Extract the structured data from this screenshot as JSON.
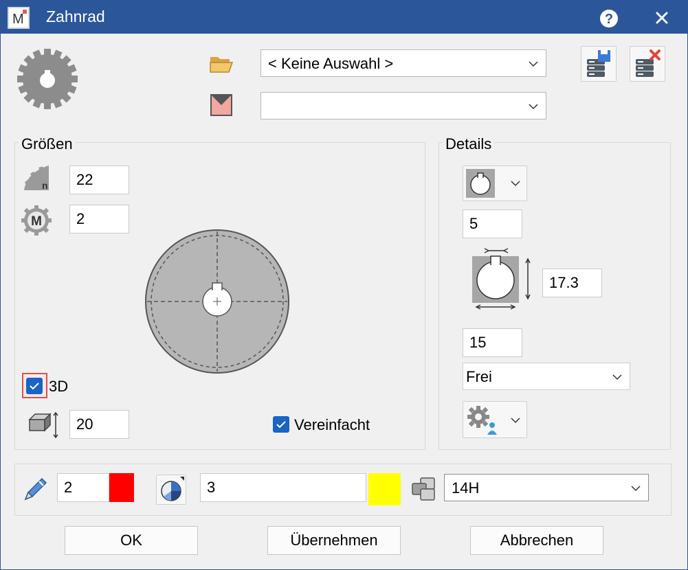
{
  "window": {
    "title": "Zahnrad"
  },
  "top": {
    "selection_combo": {
      "value": "< Keine Auswahl >"
    },
    "second_combo": {
      "value": ""
    }
  },
  "groesse": {
    "label": "Größen",
    "teeth_count": "22",
    "modul": "2",
    "three_d_label": "3D",
    "three_d_checked": true,
    "thickness": "20",
    "simplified_label": "Vereinfacht",
    "simplified_checked": true
  },
  "details": {
    "label": "Details",
    "value_a": "5",
    "value_b": "17.3",
    "value_c": "15",
    "fit_combo": "Frei"
  },
  "bottom": {
    "line_width": "2",
    "line_color": "#ff0000",
    "layer": "3",
    "fill_color": "#ffff00",
    "tolerance": "14H"
  },
  "buttons": {
    "ok": "OK",
    "apply": "Übernehmen",
    "cancel": "Abbrechen"
  }
}
